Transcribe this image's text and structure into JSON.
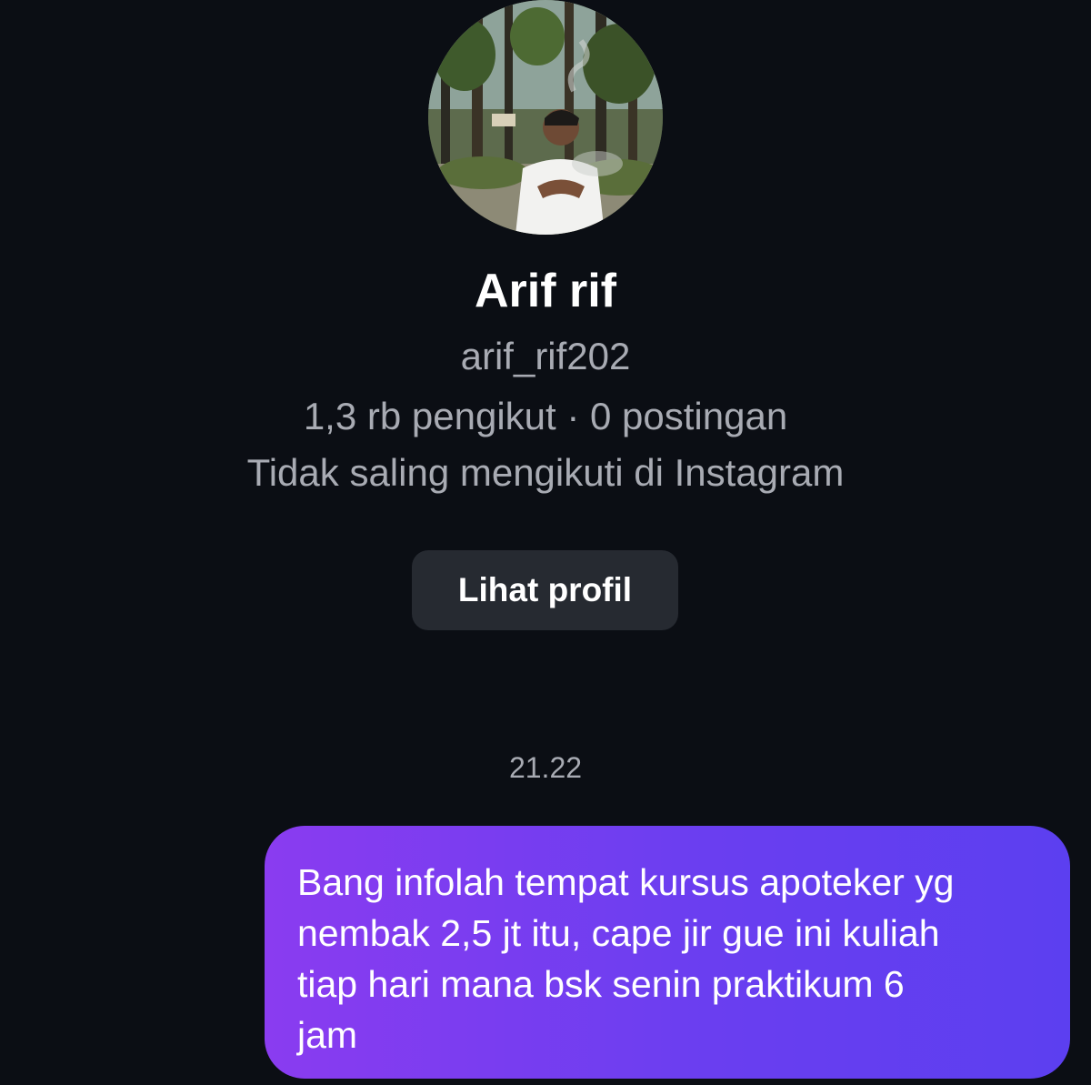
{
  "profile": {
    "avatar_icon": "profile-photo",
    "display_name": "Arif rif",
    "username": "arif_rif202",
    "stats": "1,3 rb pengikut · 0 postingan",
    "mutual_status": "Tidak saling mengikuti di Instagram",
    "view_profile_label": "Lihat profil"
  },
  "conversation": {
    "timestamp": "21.22",
    "messages": [
      {
        "sender": "me",
        "text": "Bang infolah tempat kursus apoteker yg\nnembak 2,5 jt itu, cape jir gue ini kuliah\ntiap hari mana bsk senin praktikum 6\njam"
      }
    ]
  },
  "colors": {
    "background": "#0b0e14",
    "button": "#262a31",
    "bubble_start": "#8a3cf0",
    "bubble_end": "#5c3ff0",
    "muted_text": "#a8abb3"
  }
}
